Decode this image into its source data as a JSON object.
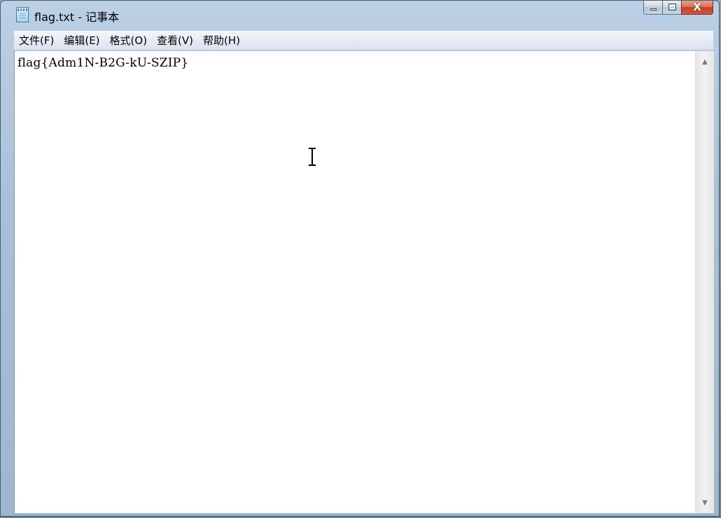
{
  "window": {
    "title": "flag.txt - 记事本",
    "icon": "notepad-icon"
  },
  "caption": {
    "minimize_icon": "minimize-icon",
    "maximize_icon": "maximize-icon",
    "close_icon": "close-icon",
    "close_glyph": "X"
  },
  "menu": {
    "items": [
      {
        "label": "文件(F)"
      },
      {
        "label": "编辑(E)"
      },
      {
        "label": "格式(O)"
      },
      {
        "label": "查看(V)"
      },
      {
        "label": "帮助(H)"
      }
    ]
  },
  "editor": {
    "text": "flag{Adm1N-B2G-kU-SZIP}",
    "cursor_icon": "text-cursor-icon"
  },
  "scrollbar": {
    "up_glyph": "▲",
    "down_glyph": "▼"
  }
}
